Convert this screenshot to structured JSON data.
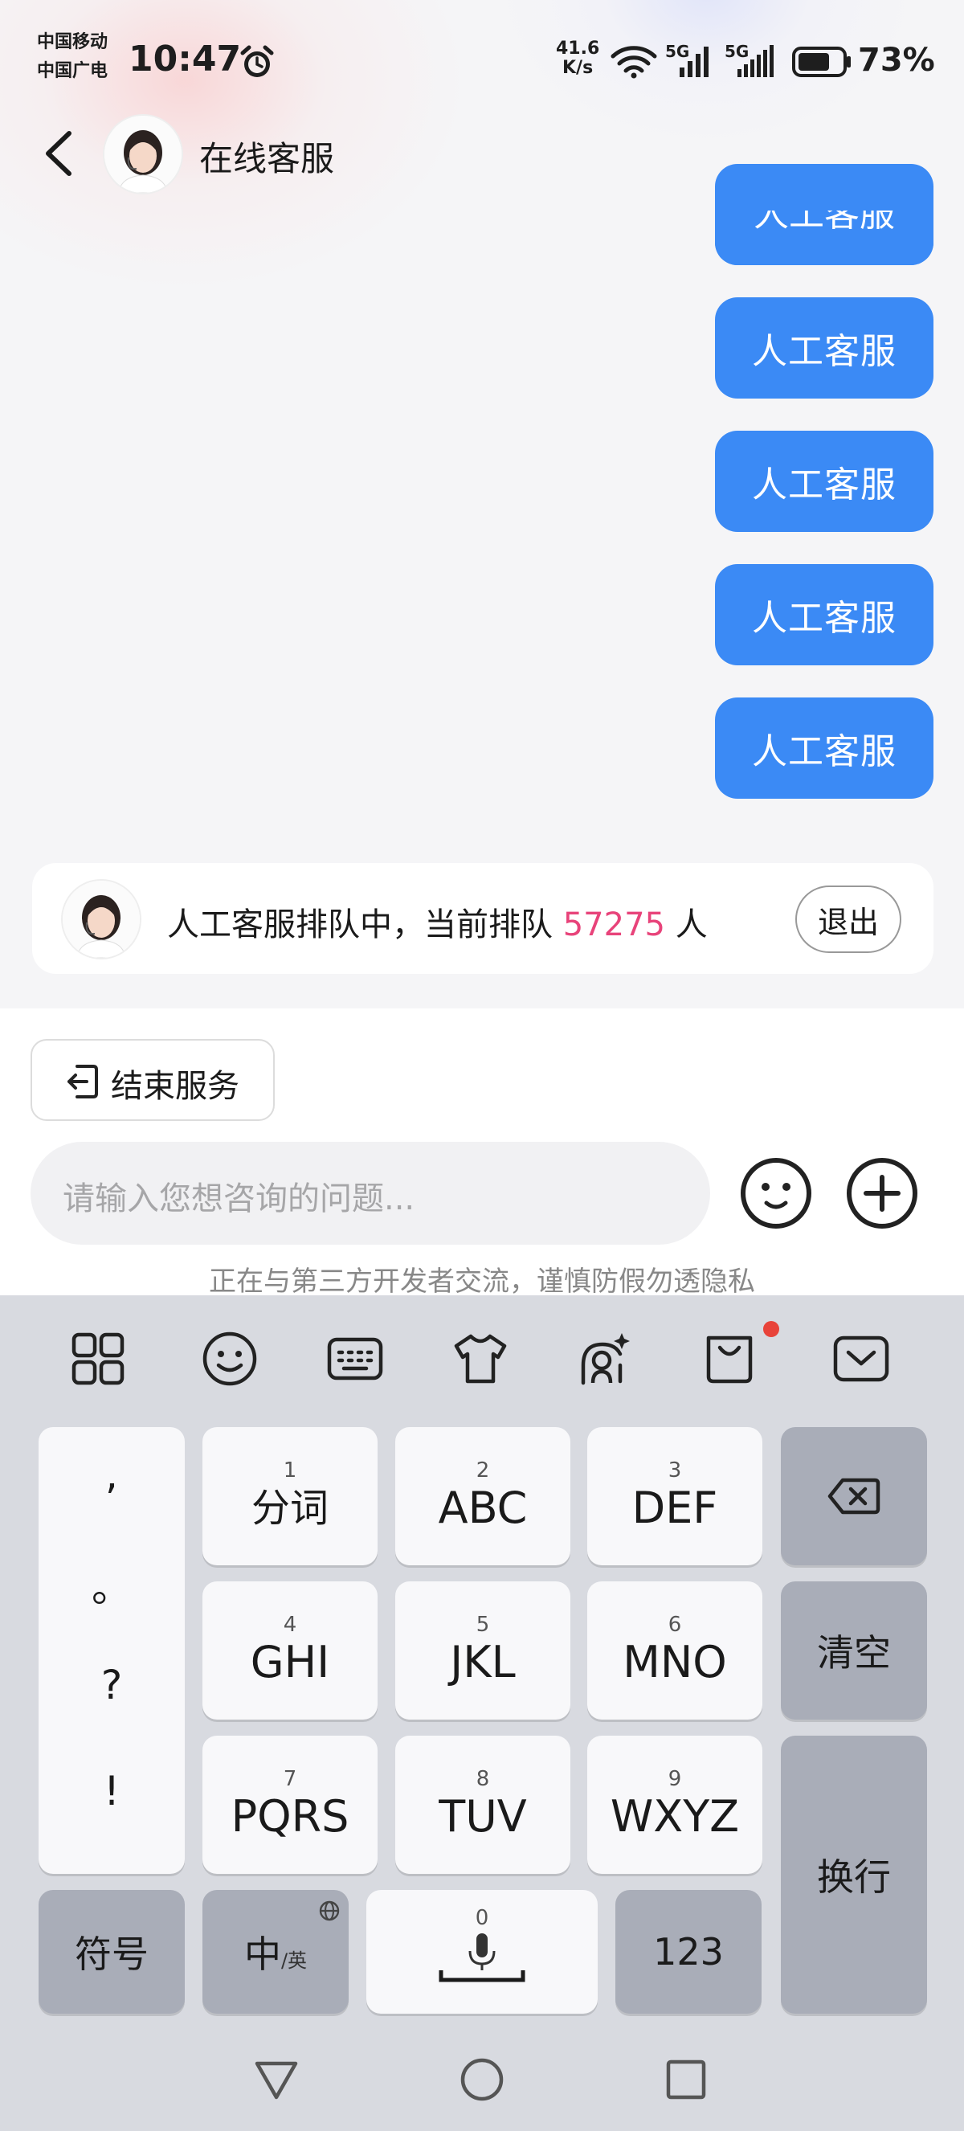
{
  "status_bar": {
    "carrier1": "中国移动",
    "carrier2": "中国广电",
    "time": "10:47",
    "net_speed_value": "41.6",
    "net_speed_unit": "K/s",
    "sig1": "5G",
    "sig2": "5G",
    "battery": "73%",
    "battery_level": 0.73
  },
  "header": {
    "title": "在线客服"
  },
  "chat": {
    "partial_bubble": "人工客服",
    "bubbles": [
      "人工客服",
      "人工客服",
      "人工客服",
      "人工客服"
    ]
  },
  "queue": {
    "text_prefix": "人工客服排队中，当前排队",
    "count": "57275",
    "text_suffix": "人",
    "exit_label": "退出",
    "count_color": "#e8437a"
  },
  "actions": {
    "end_service_label": "结束服务"
  },
  "input": {
    "placeholder": "请输入您想咨询的问题...",
    "notice": "正在与第三方开发者交流，谨慎防假勿透隐私"
  },
  "keyboard": {
    "toolbar_icons": [
      "grid-icon",
      "emoji-icon",
      "keyboard-icon",
      "shirt-icon",
      "ai-avatar-icon",
      "shopping-bag-icon",
      "collapse-keyboard-icon"
    ],
    "punct": [
      ",",
      "。",
      "?",
      "!"
    ],
    "keys": [
      {
        "num": "1",
        "label": "分词"
      },
      {
        "num": "2",
        "label": "ABC"
      },
      {
        "num": "3",
        "label": "DEF"
      },
      {
        "num": "4",
        "label": "GHI"
      },
      {
        "num": "5",
        "label": "JKL"
      },
      {
        "num": "6",
        "label": "MNO"
      },
      {
        "num": "7",
        "label": "PQRS"
      },
      {
        "num": "8",
        "label": "TUV"
      },
      {
        "num": "9",
        "label": "WXYZ"
      }
    ],
    "clear_label": "清空",
    "enter_label": "换行",
    "symbol_label": "符号",
    "lang_main": "中",
    "lang_sub": "/英",
    "space_num": "0",
    "num_label": "123"
  },
  "colors": {
    "accent": "#3b8af5",
    "notification_dot": "#e8433a"
  }
}
